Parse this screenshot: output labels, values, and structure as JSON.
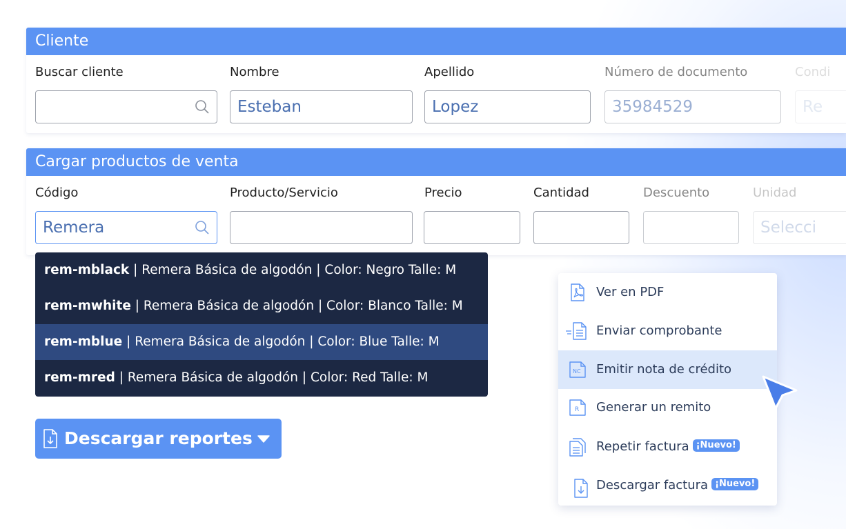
{
  "cliente": {
    "header": "Cliente",
    "fields": [
      {
        "label": "Buscar cliente",
        "value": ""
      },
      {
        "label": "Nombre",
        "value": "Esteban"
      },
      {
        "label": "Apellido",
        "value": "Lopez"
      },
      {
        "label": "Número de documento",
        "value": "35984529"
      },
      {
        "label": "Condi",
        "value": "Re"
      }
    ]
  },
  "productos": {
    "header": "Cargar productos de venta",
    "fields": [
      {
        "label": "Código",
        "value": "Remera"
      },
      {
        "label": "Producto/Servicio",
        "value": ""
      },
      {
        "label": "Precio",
        "value": ""
      },
      {
        "label": "Cantidad",
        "value": ""
      },
      {
        "label": "Descuento",
        "value": ""
      },
      {
        "label": "Unidad",
        "value": "Selecci"
      }
    ]
  },
  "suggestions": [
    {
      "code": "rem-mblack",
      "desc": " | Remera Básica de algodón | Color: Negro Talle: M"
    },
    {
      "code": "rem-mwhite",
      "desc": " | Remera Básica de algodón | Color: Blanco Talle: M"
    },
    {
      "code": "rem-mblue",
      "desc": " | Remera Básica de algodón | Color: Blue Talle: M"
    },
    {
      "code": "rem-mred",
      "desc": " | Remera Básica de algodón | Color: Red Talle: M"
    }
  ],
  "report_button": {
    "label": "Descargar reportes"
  },
  "actions_menu": {
    "items": [
      {
        "label": "Ver en PDF",
        "icon": "pdf-icon"
      },
      {
        "label": "Enviar comprobante",
        "icon": "send-document-icon"
      },
      {
        "label": "Emitir nota de crédito",
        "icon": "credit-note-icon"
      },
      {
        "label": "Generar un remito",
        "icon": "delivery-note-icon"
      },
      {
        "label": "Repetir factura",
        "icon": "repeat-invoice-icon",
        "badge": "¡Nuevo!"
      },
      {
        "label": "Descargar factura",
        "icon": "download-invoice-icon",
        "badge": "¡Nuevo!"
      }
    ]
  },
  "colors": {
    "accent": "#5b93f3",
    "dropdown_bg": "#1c2843",
    "dropdown_active": "#2f4a80",
    "menu_active": "#dce8fb"
  }
}
